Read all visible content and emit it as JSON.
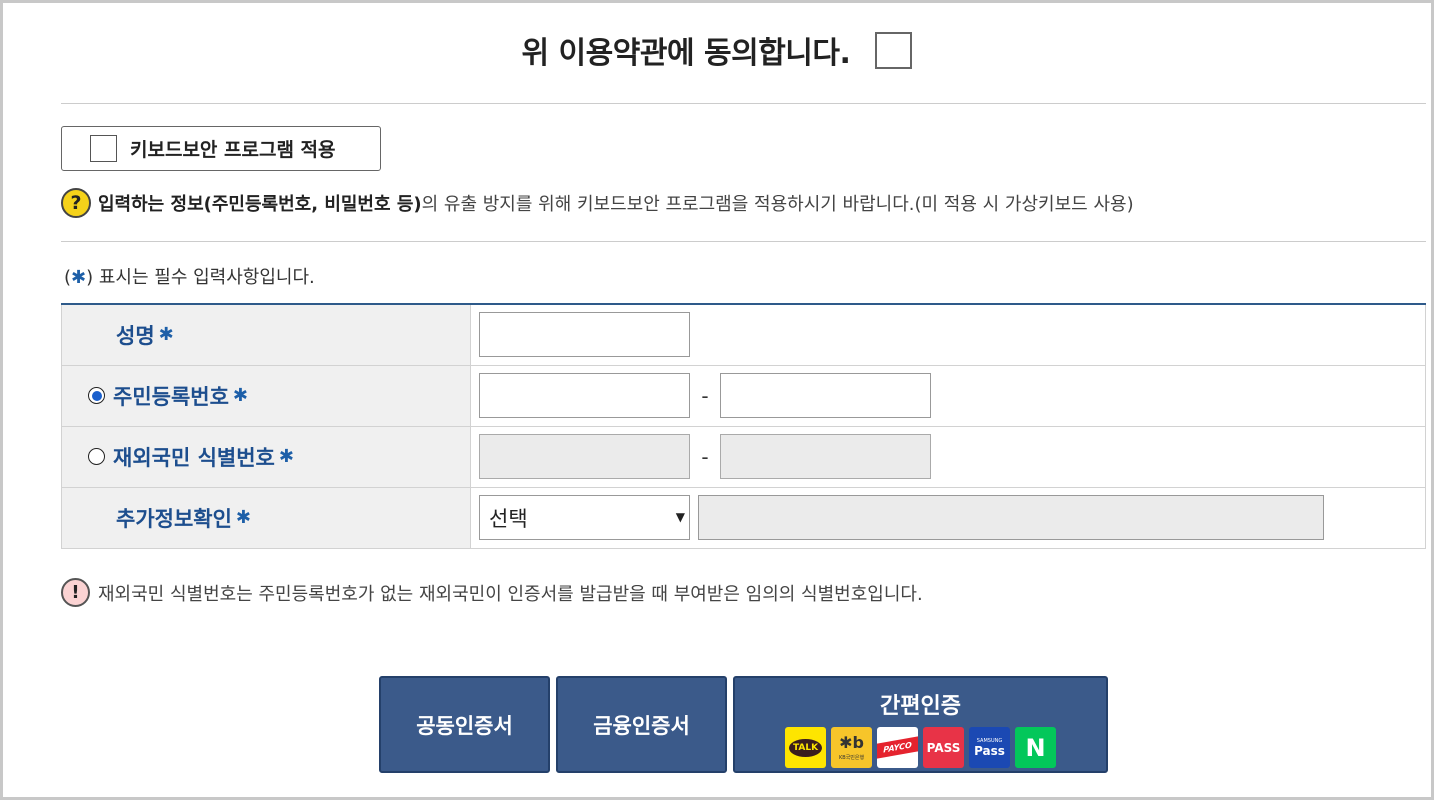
{
  "agreement": {
    "title": "위 이용약관에 동의합니다.",
    "checked": false
  },
  "keyboard_security": {
    "label": "키보드보안 프로그램 적용",
    "checked": false
  },
  "notice": {
    "icon": "question-icon",
    "bold": "입력하는 정보(주민등록번호, 비밀번호 등)",
    "rest": "의 유출 방지를 위해 키보드보안 프로그램을 적용하시기 바랍니다.(미 적용 시 가상키보드 사용)"
  },
  "required_note": {
    "open": "(",
    "star": "✱",
    "close": ") 표시는 필수 입력사항입니다."
  },
  "form": {
    "required_marker": "✱",
    "rows": [
      {
        "label": "성명"
      },
      {
        "label": "주민등록번호",
        "radio_selected": true
      },
      {
        "label": "재외국민 식별번호",
        "radio_selected": false
      },
      {
        "label": "추가정보확인"
      }
    ],
    "dash": "-",
    "select_value": "선택"
  },
  "warning": {
    "icon": "exclamation-icon",
    "text": "재외국민 식별번호는 주민등록번호가 없는 재외국민이 인증서를 발급받을 때 부여받은 임의의 식별번호입니다."
  },
  "buttons": {
    "joint_cert": "공동인증서",
    "financial_cert": "금융인증서",
    "simple_auth": "간편인증"
  },
  "simple_auth_providers": [
    {
      "icon": "kakaotalk-icon",
      "text": "TALK"
    },
    {
      "icon": "kb-bank-icon",
      "text": "KB국민은행"
    },
    {
      "icon": "payco-icon",
      "text": "PAYCO"
    },
    {
      "icon": "pass-icon",
      "text": "PASS"
    },
    {
      "icon": "samsung-pass-icon",
      "text": "Pass",
      "sub": "SAMSUNG"
    },
    {
      "icon": "naver-icon",
      "text": "N"
    }
  ],
  "colors": {
    "button_bg": "#3b5a8a",
    "label_blue": "#1d4e8e",
    "table_top_border": "#2e5a8a"
  }
}
